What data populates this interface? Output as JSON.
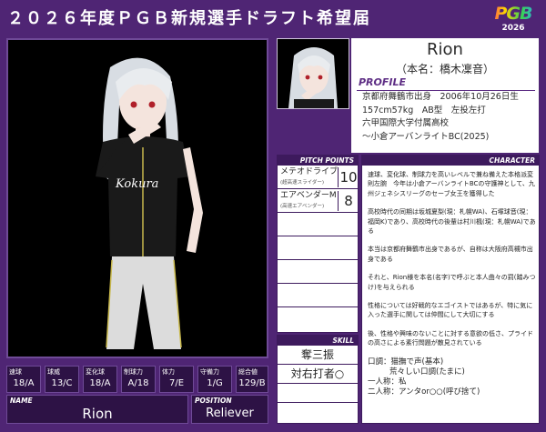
{
  "header": {
    "title": "２０２６年度ＰＧＢ新規選手ドラフト希望届",
    "logo_text": "PGB",
    "logo_year": "2026"
  },
  "player": {
    "name": "Rion",
    "real_name": "（本名：橋木凜音）",
    "photo_caption": "Kokura"
  },
  "profile": {
    "label": "PROFILE",
    "lines": [
      "京都府舞鶴市出身　2006年10月26日生",
      "157cm57kg　AB型　左投左打",
      "六甲国際大学付属高校",
      "～小倉アーバンライトBC(2025)"
    ]
  },
  "pitch_points": {
    "label": "PITCH POINTS",
    "items": [
      {
        "name": "メテオドライブ",
        "sub": "(超高速スライダー)",
        "value": "10"
      },
      {
        "name": "エアベンダーM",
        "sub": "(高速エアベンダー)",
        "value": "8"
      }
    ]
  },
  "skill": {
    "label": "SKILL",
    "items": [
      "奪三振",
      "対右打者○"
    ]
  },
  "character": {
    "label": "CHARACTER",
    "paragraphs": [
      "速球、変化球、制球力を高いレベルで兼ね備えた本格派変則左腕　今年は小倉アーバンライトBCの守護神として、九州ジェネシスリーグのセーブ女王を獲得した",
      "高校時代の同期は坂城夏梨(現：札幌WA)、石塚球音(現：福岡K)であり、高校時代の後輩は村川楓(現：札幌WA)である",
      "本当は京都府舞鶴市出身であるが、自称は大阪府高槻市出身である",
      "それと、Rion様を本名(名字)で呼ぶと本人曲々の罰(踏みつけ)を与えられる",
      "性格については好戦的なエゴイストではあるが、特に気に入った選手に関しては仲間にして大切にする",
      "後、性格や興味のないことに対する意欲の低さ、プライドの高さによる素行問題が散見されている"
    ],
    "speech_label": "口調：",
    "speech_value": "猫撫で声(基本)",
    "speech_value2": "荒々しい口調(たまに)",
    "first_person_label": "一人称：",
    "first_person_value": "私",
    "second_person_label": "二人称：",
    "second_person_value": "アンタor○○(呼び捨て)"
  },
  "stats": [
    {
      "label": "速球",
      "value": "18/A"
    },
    {
      "label": "球威",
      "value": "13/C"
    },
    {
      "label": "変化球",
      "value": "18/A"
    },
    {
      "label": "制球力",
      "value": "A/18"
    },
    {
      "label": "体力",
      "value": "7/E"
    },
    {
      "label": "守備力",
      "value": "1/G"
    },
    {
      "label": "総合値",
      "value": "129/B"
    }
  ],
  "footer": {
    "name_label": "NAME",
    "name_value": "Rion",
    "position_label": "POSITION",
    "position_value": "Reliever"
  },
  "colors": {
    "background": "#4f2574",
    "panel_dark": "#2d1245",
    "accent": "#5d2d84"
  }
}
